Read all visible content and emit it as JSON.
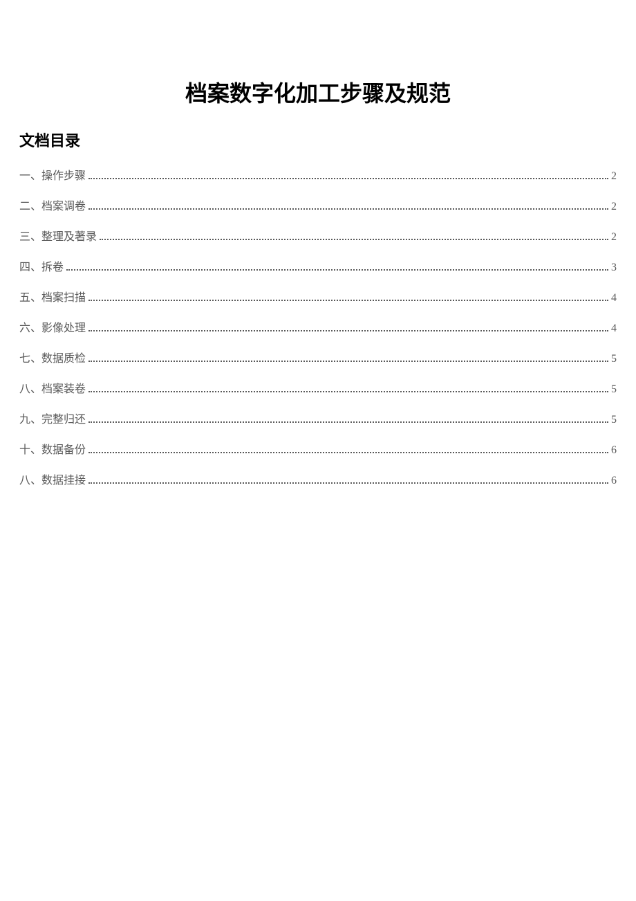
{
  "title": "档案数字化加工步骤及规范",
  "toc_heading": "文档目录",
  "toc": [
    {
      "label": "一、操作步骤",
      "page": "2"
    },
    {
      "label": "二、档案调卷",
      "page": "2"
    },
    {
      "label": "三、整理及著录",
      "page": "2"
    },
    {
      "label": "四、拆卷",
      "page": "3"
    },
    {
      "label": "五、档案扫描",
      "page": "4"
    },
    {
      "label": "六、影像处理",
      "page": "4"
    },
    {
      "label": "七、数据质检",
      "page": "5"
    },
    {
      "label": "八、档案装卷",
      "page": "5"
    },
    {
      "label": "九、完整归还",
      "page": "5"
    },
    {
      "label": "十、数据备份",
      "page": "6"
    },
    {
      "label": "八、数据挂接",
      "page": "6"
    }
  ]
}
